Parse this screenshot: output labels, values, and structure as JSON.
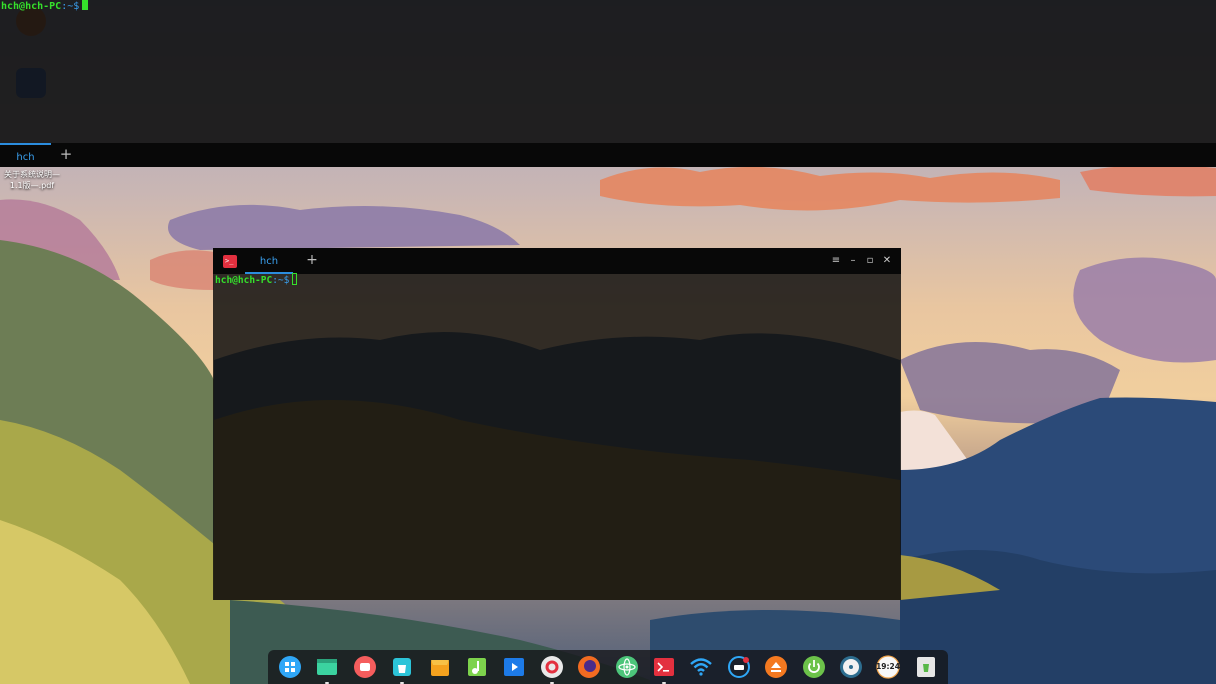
{
  "quake_terminal": {
    "prompt_user": "hch@hch-PC",
    "prompt_path": ":~$",
    "tab_label": "hch",
    "add_tab": "+"
  },
  "terminal_window": {
    "tab_label": "hch",
    "add_tab": "+",
    "prompt_user": "hch@hch-PC",
    "prompt_path": ":~$",
    "menu_glyph": "≡",
    "minimize_glyph": "–",
    "maximize_glyph": "▫",
    "close_glyph": "✕"
  },
  "desktop": {
    "file_label_line1": "关于系统说明—",
    "file_label_line2": "1.1版—.pdf"
  },
  "dock": {
    "apps": [
      {
        "name": "launcher-icon",
        "color": "#2fa7f7"
      },
      {
        "name": "file-manager-icon",
        "color": "#3bd3a0"
      },
      {
        "name": "screen-recorder-icon",
        "color": "#f55d5d"
      },
      {
        "name": "app-store-icon",
        "color": "#2cc4d8"
      },
      {
        "name": "deepin-store-icon",
        "color": "#f4a21e"
      },
      {
        "name": "music-icon",
        "color": "#7dd34c"
      },
      {
        "name": "video-player-icon",
        "color": "#1d7be8"
      },
      {
        "name": "control-center-icon",
        "color": "#e9e9e9"
      },
      {
        "name": "firefox-icon",
        "color": "#f26b21"
      },
      {
        "name": "atom-icon",
        "color": "#4cc57a"
      },
      {
        "name": "terminal-icon",
        "color": "#e3303f"
      },
      {
        "name": "wifi-icon",
        "color": "#2fa7f7"
      },
      {
        "name": "keyboard-icon",
        "color": "#2fa7f7"
      },
      {
        "name": "eject-icon",
        "color": "#f47920"
      },
      {
        "name": "power-icon",
        "color": "#6cc24a"
      },
      {
        "name": "disk-icon",
        "color": "#e6e6e6"
      },
      {
        "name": "clock-icon",
        "color": "#f8f8f8"
      },
      {
        "name": "trash-icon",
        "color": "#e6e6e6"
      }
    ],
    "clock_text": "19:24"
  }
}
